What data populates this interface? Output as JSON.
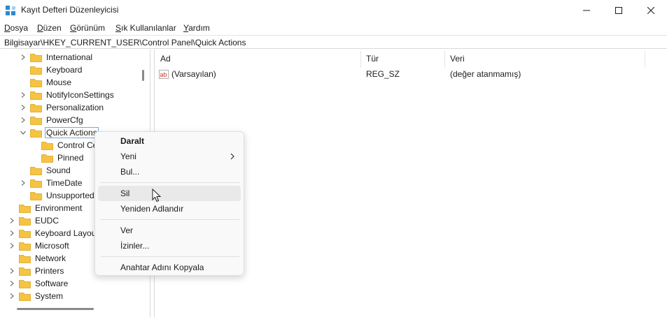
{
  "window": {
    "title": "Kayıt Defteri Düzenleyicisi",
    "controls": [
      "minimize-icon",
      "maximize-icon",
      "close-icon"
    ]
  },
  "menu": [
    {
      "accel": "D",
      "rest": "osya"
    },
    {
      "accel": "D",
      "rest": "üzen"
    },
    {
      "accel": "G",
      "rest": "örünüm"
    },
    {
      "accel": "S",
      "rest": "ık Kullanılanlar"
    },
    {
      "accel": "Y",
      "rest": "ardım"
    }
  ],
  "address": "Bilgisayar\\HKEY_CURRENT_USER\\Control Panel\\Quick Actions",
  "tree": [
    {
      "label": "International",
      "chevron": "right"
    },
    {
      "label": "Keyboard",
      "chevron": "none"
    },
    {
      "label": "Mouse",
      "chevron": "none"
    },
    {
      "label": "NotifyIconSettings",
      "chevron": "right"
    },
    {
      "label": "Personalization",
      "chevron": "right"
    },
    {
      "label": "PowerCfg",
      "chevron": "right"
    },
    {
      "label": "Quick Actions",
      "chevron": "down",
      "selected": true
    },
    {
      "label": "Control Ce",
      "chevron": "none"
    },
    {
      "label": "Pinned",
      "chevron": "none"
    },
    {
      "label": "Sound",
      "chevron": "none"
    },
    {
      "label": "TimeDate",
      "chevron": "right"
    },
    {
      "label": "UnsupportedI",
      "chevron": "none"
    },
    {
      "label": "Environment",
      "chevron": "none"
    },
    {
      "label": "EUDC",
      "chevron": "right"
    },
    {
      "label": "Keyboard Layout",
      "chevron": "right"
    },
    {
      "label": "Microsoft",
      "chevron": "right"
    },
    {
      "label": "Network",
      "chevron": "none"
    },
    {
      "label": "Printers",
      "chevron": "right"
    },
    {
      "label": "Software",
      "chevron": "right"
    },
    {
      "label": "System",
      "chevron": "right"
    }
  ],
  "list": {
    "columns": [
      "Ad",
      "Tür",
      "Veri"
    ],
    "rows": [
      {
        "name": "(Varsayılan)",
        "type": "REG_SZ",
        "data": "(değer atanmamış)",
        "icon": "string-value-icon"
      }
    ]
  },
  "context_menu": {
    "items": [
      {
        "label": "Daralt",
        "bold": true
      },
      {
        "label": "Yeni",
        "submenu": true
      },
      {
        "label": "Bul..."
      },
      {
        "label": "Sil",
        "hover": true
      },
      {
        "label": "Yeniden Adlandır"
      },
      {
        "label": "Ver"
      },
      {
        "label": "İzinler..."
      },
      {
        "label": "Anahtar Adını Kopyala"
      }
    ]
  },
  "colors": {
    "folder": "#f6c342",
    "selection_border": "#7aa7d9",
    "menu_hover": "#e9e9e9"
  }
}
